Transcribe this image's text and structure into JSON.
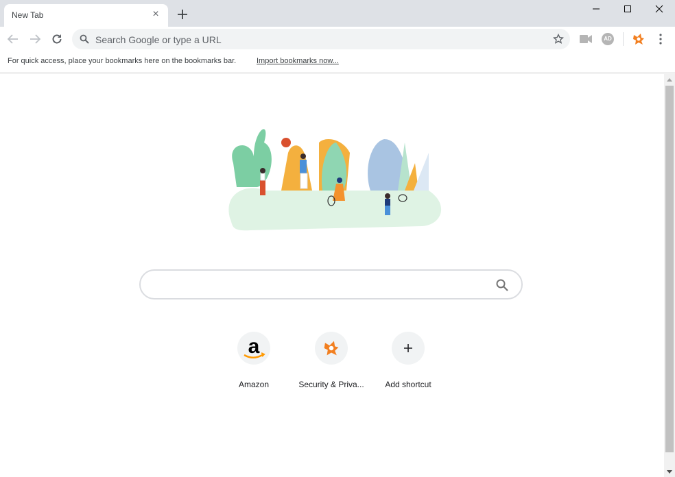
{
  "window": {
    "tab_title": "New Tab",
    "close_tab_glyph": "×",
    "controls": [
      "minimize",
      "maximize",
      "close"
    ]
  },
  "toolbar": {
    "omnibox_placeholder": "Search Google or type a URL",
    "icons": [
      "back-icon",
      "forward-icon",
      "reload-icon",
      "search-icon",
      "bookmark-star-icon",
      "camera-icon",
      "adblock-icon",
      "avast-icon",
      "menu-icon"
    ],
    "adblock_label": "AD"
  },
  "bookmarks_bar": {
    "message": "For quick access, place your bookmarks here on the bookmarks bar.",
    "import_link": "Import bookmarks now..."
  },
  "ntp": {
    "search_value": "",
    "shortcuts": [
      {
        "label": "Amazon",
        "icon": "amazon-icon"
      },
      {
        "label": "Security & Priva...",
        "icon": "avast-icon"
      },
      {
        "label": "Add shortcut",
        "icon": "plus-icon"
      }
    ]
  },
  "colors": {
    "titlebar": "#dee1e6",
    "omnibox": "#f1f3f4",
    "avast_orange": "#f27f20",
    "amazon_orange": "#f90"
  }
}
